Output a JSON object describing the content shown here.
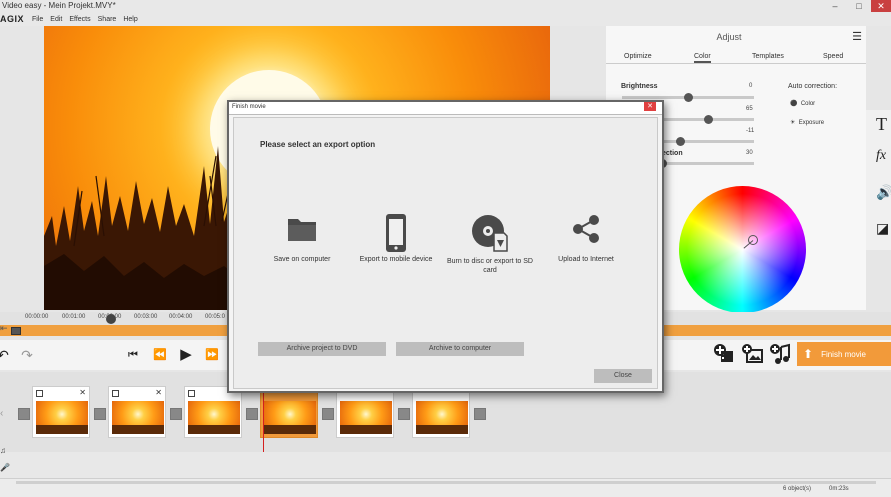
{
  "app": {
    "window_title": "Video easy - Mein Projekt.MVY*",
    "brand": "AGIX",
    "menu": [
      "File",
      "Edit",
      "Effects",
      "Share",
      "Help"
    ],
    "window_controls": [
      "–",
      "□",
      "✕"
    ]
  },
  "timeline": {
    "ticks": [
      "00:00:00",
      "00:01:00",
      "00:02:00",
      "00:03:00",
      "00:04:00",
      "00:05:0"
    ]
  },
  "transport": {
    "undo": "↶",
    "redo": "↷",
    "prev": "⏮",
    "rewind": "⏪",
    "play": "▶",
    "forward": "⏩"
  },
  "finish": {
    "label": "Finish movie"
  },
  "adjust": {
    "title": "Adjust",
    "tabs": [
      "Optimize",
      "Color",
      "Templates",
      "Speed"
    ],
    "active_tab": "Color",
    "brightness_label": "Brightness",
    "values": [
      "0",
      "65",
      "-11",
      "30"
    ],
    "slider_positions": [
      0.5,
      0.65,
      0.44,
      0.3
    ],
    "correction_label": "ection",
    "auto_correction": "Auto correction:",
    "auto_options": [
      "Color",
      "Exposure"
    ]
  },
  "dialog": {
    "title": "Finish movie",
    "heading": "Please select an export option",
    "options": [
      {
        "label": "Save on computer",
        "icon": "folder-icon"
      },
      {
        "label": "Export to mobile device",
        "icon": "phone-icon"
      },
      {
        "label": "Burn to disc or export to SD card",
        "icon": "disc-sd-icon"
      },
      {
        "label": "Upload to Internet",
        "icon": "share-icon"
      }
    ],
    "archive_dvd": "Archive project to DVD",
    "archive_computer": "Archive to computer",
    "close": "Close"
  },
  "statusbar": {
    "objects": "6 object(s)",
    "duration": "0m:23s"
  },
  "colors": {
    "accent": "#f29a3a",
    "dialog_border": "#666666",
    "playhead": "#d42020"
  }
}
